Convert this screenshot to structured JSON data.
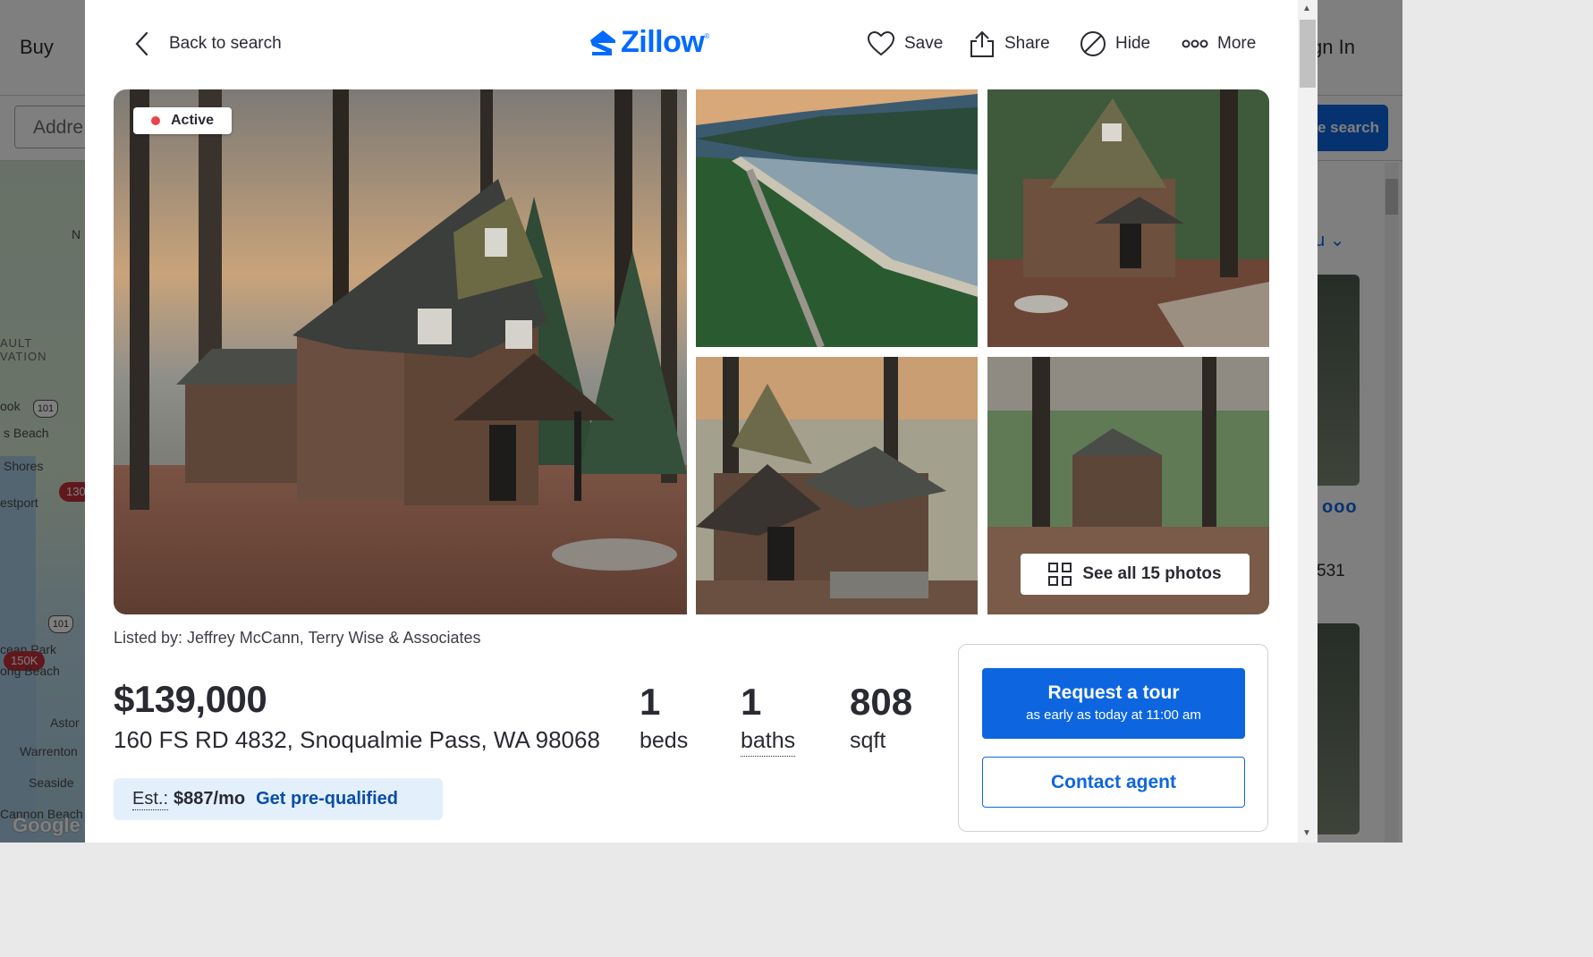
{
  "background": {
    "nav_buy": "Buy",
    "nav_sign_in": "gn In",
    "address_placeholder": "Addre",
    "save_search": "ve search",
    "map_labels": [
      "N",
      "AULT",
      "VATION",
      "ook",
      "s Beach",
      "Shores",
      "estport",
      "cean Park",
      "ong Beach",
      "Astor",
      "Warrenton",
      "Seaside",
      "Cannon Beach"
    ],
    "map_shields": [
      "101",
      "101"
    ],
    "map_pins": [
      "130",
      "150K"
    ],
    "map_google": "Google",
    "list_sort_fragment": "u",
    "list_more_dots": "ooo",
    "list_number_fragment": "531"
  },
  "header": {
    "back_label": "Back to search",
    "brand": "Zillow",
    "brand_reg": "®",
    "save_label": "Save",
    "share_label": "Share",
    "hide_label": "Hide",
    "more_label": "More"
  },
  "gallery": {
    "status_badge": "Active",
    "see_all_label": "See all 15 photos",
    "photo_count": 15
  },
  "listing": {
    "listed_by": "Listed by: Jeffrey McCann, Terry Wise & Associates",
    "price": "$139,000",
    "address": "160 FS RD 4832, Snoqualmie Pass, WA 98068",
    "beds_value": "1",
    "beds_label": "beds",
    "baths_value": "1",
    "baths_label": "baths",
    "sqft_value": "808",
    "sqft_label": "sqft"
  },
  "estimate": {
    "label": "Est.:",
    "amount": "$887/mo",
    "prequalify_label": "Get pre-qualified"
  },
  "cta": {
    "tour_label": "Request a tour",
    "tour_sub": "as early as today at 11:00 am",
    "contact_label": "Contact agent"
  },
  "colors": {
    "brand_blue": "#006aff",
    "button_blue": "#0d66e0",
    "active_dot": "#e8444a",
    "estimate_bg": "#e3f0fc"
  }
}
